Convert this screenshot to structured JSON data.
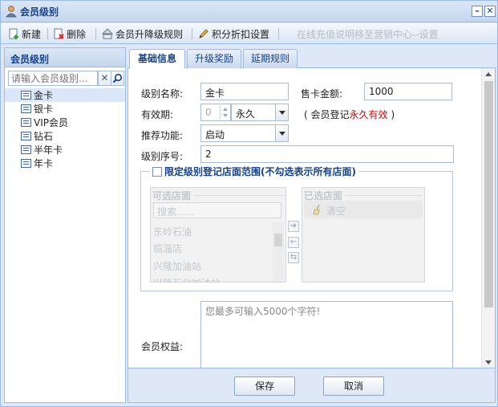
{
  "window": {
    "title": "会员级别",
    "minimize": "–",
    "close": "✕"
  },
  "toolbar": {
    "new_label": "新建",
    "delete_label": "删除",
    "upgrade_rules_label": "会员升降级规则",
    "points_discount_label": "积分折扣设置",
    "online_recharge_label": "在线充值说明移至营销中心--设置"
  },
  "sidebar": {
    "title": "会员级别",
    "search_placeholder": "请输入会员级别...",
    "clear_symbol": "✕",
    "items": [
      {
        "label": "金卡",
        "selected": true
      },
      {
        "label": "银卡"
      },
      {
        "label": "VIP会员"
      },
      {
        "label": "钻石"
      },
      {
        "label": "半年卡"
      },
      {
        "label": "年卡"
      }
    ]
  },
  "tabs": [
    {
      "label": "基础信息",
      "active": true
    },
    {
      "label": "升级奖励"
    },
    {
      "label": "延期规则"
    }
  ],
  "form": {
    "level_name_label": "级别名称:",
    "level_name_value": "金卡",
    "sale_price_label": "售卡金额:",
    "sale_price_value": "1000",
    "validity_label": "有效期:",
    "validity_number": "0",
    "validity_unit": "永久",
    "validity_note_prefix": "( 会员登记",
    "validity_note_highlight": "永久有效",
    "validity_note_suffix": ")",
    "recommend_label": "推荐功能:",
    "recommend_value": "启动",
    "order_label": "级别序号:",
    "order_value": "2",
    "restrict_store_label": "限定级别登记店面范围(不勾选表示所有店面)",
    "available_stores_title": "可选店面",
    "store_search_placeholder": "搜索......",
    "available_stores": [
      "东岭石油",
      "临淄店",
      "兴隆加油站",
      "兴隆石化加油站"
    ],
    "selected_stores_title": "已选店面",
    "clear_label": "清空",
    "benefits_label": "会员权益:",
    "benefits_placeholder": "您最多可输入5000个字符!"
  },
  "buttons": {
    "save_label": "保存",
    "cancel_label": "取消"
  },
  "colors": {
    "accent": "#15428b",
    "border": "#99bbe8",
    "highlight_red": "#e00000"
  }
}
